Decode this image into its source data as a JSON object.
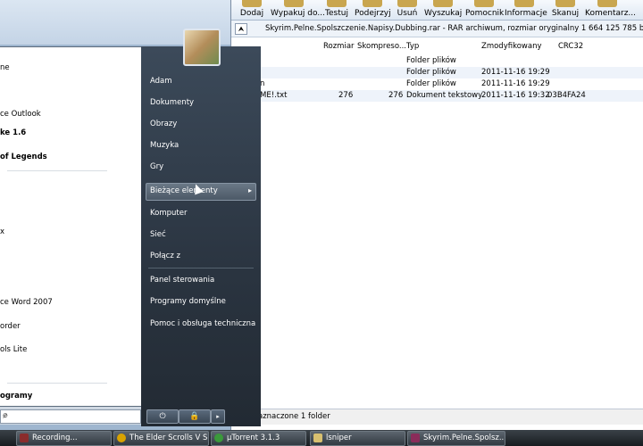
{
  "winrar": {
    "toolbar": [
      "Dodaj",
      "Wypakuj do...",
      "Testuj",
      "Podejrzyj",
      "Usuń",
      "Wyszukaj",
      "Pomocnik",
      "Informacje",
      "Skanuj",
      "Komentarz..."
    ],
    "path": "Skyrim.Pelne.Spolszczenie.Napisy.Dubbing.rar - RAR archiwum, rozmiar oryginalny 1 664 125 785 bajtów",
    "columns": [
      "Rozmiar",
      "Skompreso...",
      "Typ",
      "Zmodyfikowany",
      "CRC32"
    ],
    "rows": [
      {
        "name": "",
        "size": "",
        "packed": "",
        "type": "Folder plików",
        "modified": "",
        "crc": ""
      },
      {
        "name": "",
        "size": "",
        "packed": "",
        "type": "Folder plików",
        "modified": "2011-11-16 19:29",
        "crc": ""
      },
      {
        "name": "n",
        "size": "",
        "packed": "",
        "type": "Folder plików",
        "modified": "2011-11-16 19:29",
        "crc": ""
      },
      {
        "name": "ME!.txt",
        "size": "276",
        "packed": "276",
        "type": "Dokument tekstowy",
        "modified": "2011-11-16 19:32",
        "crc": "03B4FA24"
      }
    ],
    "status": "aznaczone 1 folder"
  },
  "start_menu": {
    "left_items": [
      {
        "label": "ne",
        "bold": false
      },
      {
        "label": "ce Outlook",
        "bold": false
      },
      {
        "label": "ke 1.6",
        "bold": true
      },
      {
        "label": "of Legends",
        "bold": true
      },
      {
        "label": "",
        "bold": false
      },
      {
        "label": "",
        "bold": false
      },
      {
        "label": "x",
        "bold": false
      },
      {
        "label": "ce Word 2007",
        "bold": false
      },
      {
        "label": "order",
        "bold": false
      },
      {
        "label": "ols Lite",
        "bold": false
      },
      {
        "label": "ogramy",
        "bold": true
      }
    ],
    "right_items": [
      "Adam",
      "Dokumenty",
      "Obrazy",
      "Muzyka",
      "Gry",
      "Bieżące elementy",
      "Komputer",
      "Sieć",
      "Połącz z",
      "Panel sterowania",
      "Programy domyślne",
      "Pomoc i obsługa techniczna"
    ],
    "search_placeholder": "e"
  },
  "taskbar": [
    {
      "label": "Recording...",
      "color": "#8a2c2c"
    },
    {
      "label": "The Elder Scrolls V S...",
      "color": "#d9a300"
    },
    {
      "label": "µTorrent 3.1.3",
      "color": "#3b9a3b"
    },
    {
      "label": "lsniper",
      "color": "#d8c070"
    },
    {
      "label": "Skyrim.Pelne.Spolsz...",
      "color": "#8a2c5a"
    }
  ]
}
